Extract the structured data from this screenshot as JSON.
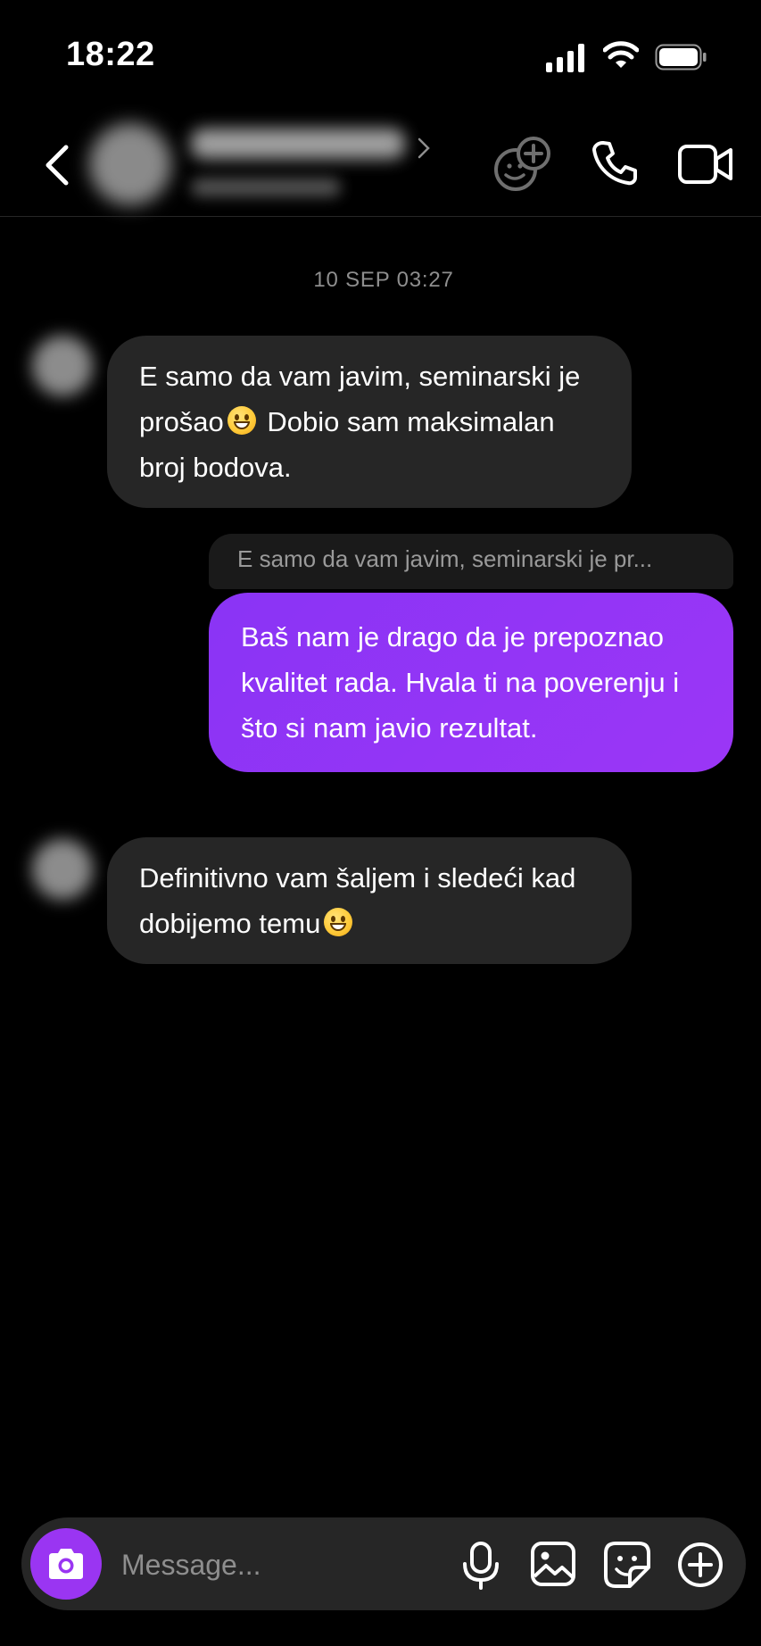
{
  "status_bar": {
    "time": "18:22"
  },
  "thread": {
    "date_label": "10 SEP 03:27",
    "messages": [
      {
        "from": "them",
        "text_before_emoji": "E samo da vam javim, seminarski je prošao",
        "emoji": "grinning-face",
        "text_after_emoji": " Dobio sam maksimalan broj bodova."
      },
      {
        "from": "me",
        "reply_preview": "E samo da vam javim, seminarski je pr...",
        "text": "Baš nam je drago da je prepoznao kvalitet rada. Hvala ti na poverenju i što si nam javio rezultat."
      },
      {
        "from": "them",
        "text_before_emoji": "Definitivno vam šaljem i sledeći kad dobijemo temu",
        "emoji": "grinning-face"
      }
    ]
  },
  "composer": {
    "placeholder": "Message..."
  },
  "colors": {
    "outgoing_bubble": "#9335f5",
    "incoming_bubble": "#262626",
    "camera_button": "#9a35f2",
    "background": "#000000"
  },
  "icons": [
    "back-chevron-icon",
    "effects-icon",
    "phone-icon",
    "video-icon",
    "camera-icon",
    "microphone-icon",
    "gallery-icon",
    "sticker-icon",
    "plus-icon"
  ]
}
